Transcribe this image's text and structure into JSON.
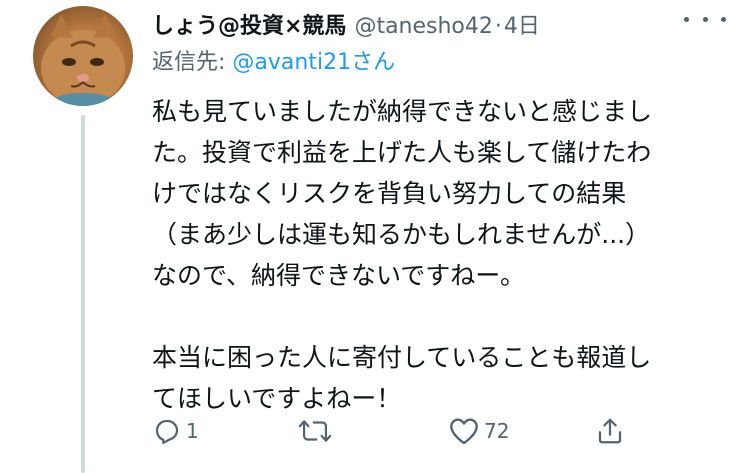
{
  "tweet": {
    "author_name": "しょう@投資×競馬",
    "author_handle": "@tanesho42",
    "separator": "·",
    "time": "4日",
    "reply_prefix": "返信先: ",
    "reply_mention": "@avanti21",
    "reply_suffix": "さん",
    "body_lines": [
      "私も見ていましたが納得できないと感じまし",
      "た。投資で利益を上げた人も楽して儲けたわ",
      "けではなくリスクを背負い努力しての結果",
      "（まあ少しは運も知るかもしれませんが...）",
      "なので、納得できないですねー。",
      "",
      "本当に困った人に寄付していることも報道し",
      "てほしいですよねー！"
    ],
    "reply_count": "1",
    "retweet_count": "",
    "like_count": "72"
  },
  "icons": {
    "avatar": "cat-avatar",
    "more": "more-icon",
    "reply": "reply-icon",
    "retweet": "retweet-icon",
    "like": "heart-icon",
    "share": "share-icon"
  },
  "colors": {
    "text": "#0f1419",
    "secondary": "#536471",
    "link": "#1d9bf0",
    "thread_line": "#cfd9de"
  }
}
